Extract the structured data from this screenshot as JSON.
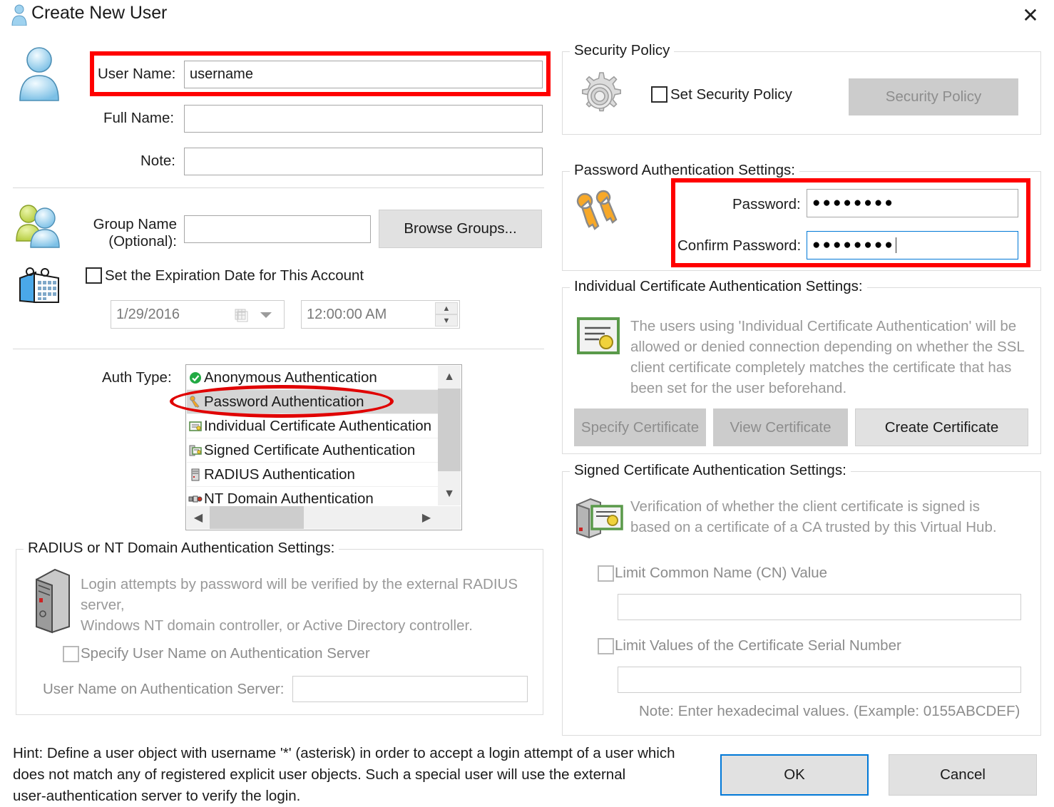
{
  "window": {
    "title": "Create New User",
    "close_label": "✕"
  },
  "user": {
    "user_name_label": "User Name:",
    "user_name_value": "username",
    "full_name_label": "Full Name:",
    "full_name_value": "",
    "note_label": "Note:",
    "note_value": ""
  },
  "group": {
    "group_name_label_line1": "Group Name",
    "group_name_label_line2": "(Optional):",
    "group_name_value": "",
    "browse_groups_label": "Browse Groups..."
  },
  "expiration": {
    "checkbox_label": "Set the Expiration Date for This Account",
    "checked": false,
    "date_value": "1/29/2016",
    "time_value": "12:00:00 AM"
  },
  "auth_type": {
    "label": "Auth Type:",
    "selected": "Password Authentication",
    "items": [
      {
        "label": "Anonymous Authentication",
        "icon": "green-check-icon",
        "selected": false
      },
      {
        "label": "Password Authentication",
        "icon": "key-icon",
        "selected": true
      },
      {
        "label": "Individual Certificate Authentication",
        "icon": "certificate-icon",
        "selected": false
      },
      {
        "label": "Signed Certificate Authentication",
        "icon": "signed-certificate-icon",
        "selected": false
      },
      {
        "label": "RADIUS Authentication",
        "icon": "server-icon",
        "selected": false
      },
      {
        "label": "NT Domain Authentication",
        "icon": "domain-icon",
        "selected": false
      }
    ]
  },
  "radius": {
    "group_title": "RADIUS or NT Domain Authentication Settings:",
    "description_line1": "Login attempts by password will be verified by the external RADIUS server,",
    "description_line2": "Windows NT domain controller, or Active Directory controller.",
    "specify_user_checkbox_label": "Specify User Name on Authentication Server",
    "specify_user_checked": false,
    "user_name_label": "User Name on Authentication Server:",
    "user_name_value": ""
  },
  "security_policy": {
    "group_title": "Security Policy",
    "checkbox_label": "Set Security Policy",
    "checked": false,
    "button_label": "Security Policy",
    "button_disabled": true
  },
  "password_auth": {
    "group_title": "Password Authentication Settings:",
    "password_label": "Password:",
    "password_value": "●●●●●●●●",
    "confirm_label": "Confirm Password:",
    "confirm_value": "●●●●●●●●"
  },
  "individual_cert": {
    "group_title": "Individual Certificate Authentication Settings:",
    "description": "The users using 'Individual Certificate Authentication' will be allowed or denied connection depending on whether the SSL client certificate completely matches the certificate that has been set for the user beforehand.",
    "description_lines": [
      "The users using 'Individual Certificate Authentication' will be",
      "allowed or denied connection depending on whether the SSL",
      "client certificate completely matches the certificate that has",
      "been set for the user beforehand."
    ],
    "specify_certificate_label": "Specify Certificate",
    "view_certificate_label": "View Certificate",
    "create_certificate_label": "Create Certificate"
  },
  "signed_cert": {
    "group_title": "Signed Certificate Authentication Settings:",
    "description_lines": [
      "Verification of whether the client certificate is signed is",
      "based on a certificate of a CA trusted by this Virtual Hub."
    ],
    "limit_cn_label": "Limit Common Name (CN) Value",
    "limit_cn_checked": false,
    "cn_value": "",
    "limit_serial_label": "Limit Values of the Certificate Serial Number",
    "limit_serial_checked": false,
    "serial_value": "",
    "note": "Note: Enter hexadecimal values. (Example: 0155ABCDEF)"
  },
  "footer": {
    "hint_lines": [
      "Hint: Define a user object with username '*' (asterisk) in order to accept a login attempt of a user which",
      "does not match any of registered explicit user objects. Such a special user will use the external",
      "user-authentication server to verify the login."
    ],
    "ok_label": "OK",
    "cancel_label": "Cancel"
  },
  "colors": {
    "annotation_red": "#ff0000",
    "focus_blue": "#0078d7",
    "disabled_gray": "#cccccc"
  }
}
